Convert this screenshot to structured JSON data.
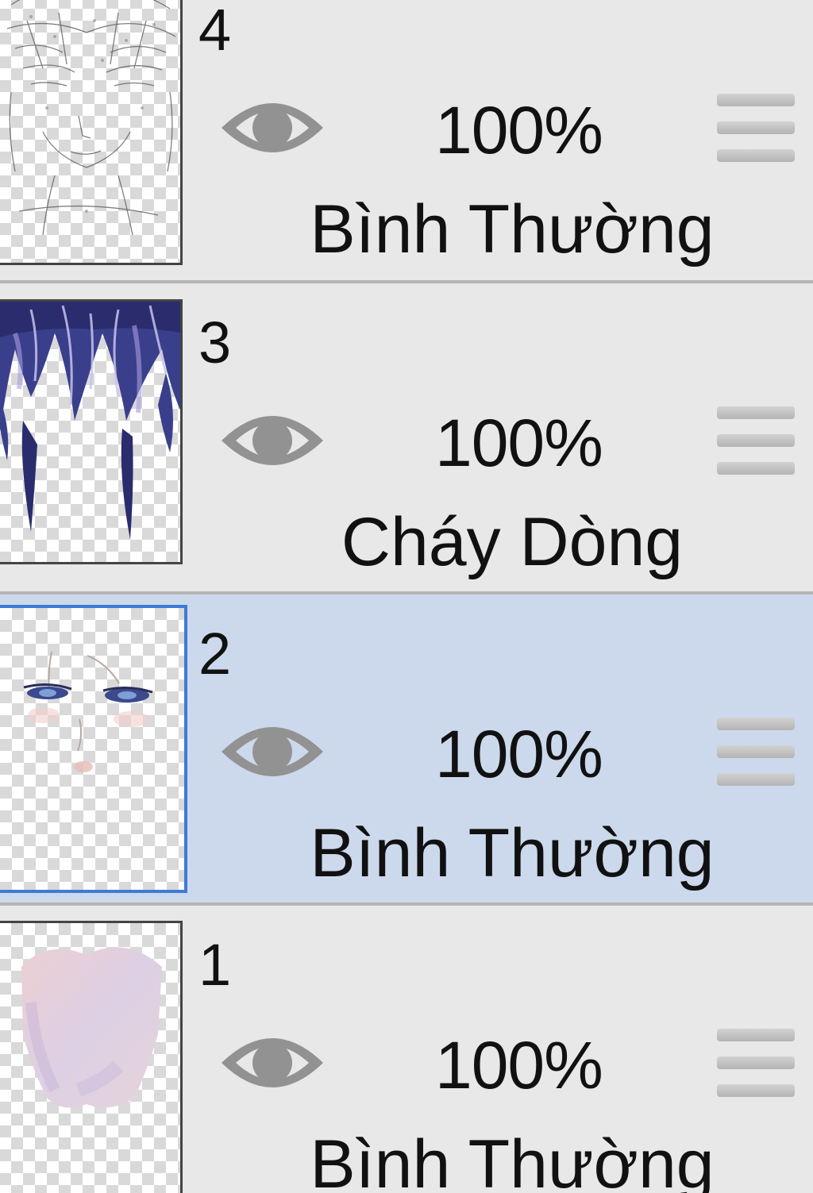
{
  "layers": [
    {
      "number": "4",
      "opacity": "100%",
      "blend_mode": "Bình Thường",
      "visible": true,
      "selected": false,
      "thumbnail": "face-lineart"
    },
    {
      "number": "3",
      "opacity": "100%",
      "blend_mode": "Cháy Dòng",
      "visible": true,
      "selected": false,
      "thumbnail": "hair"
    },
    {
      "number": "2",
      "opacity": "100%",
      "blend_mode": "Bình Thường",
      "visible": true,
      "selected": true,
      "thumbnail": "eyes"
    },
    {
      "number": "1",
      "opacity": "100%",
      "blend_mode": "Bình Thường",
      "visible": true,
      "selected": false,
      "thumbnail": "skin"
    }
  ],
  "colors": {
    "background": "#e8e8e8",
    "selected_background": "#ccd9ec",
    "selected_border": "#3d7bd6",
    "icon_gray": "#929292"
  },
  "icons": {
    "visibility": "eye-icon",
    "reorder": "drag-handle-icon"
  }
}
